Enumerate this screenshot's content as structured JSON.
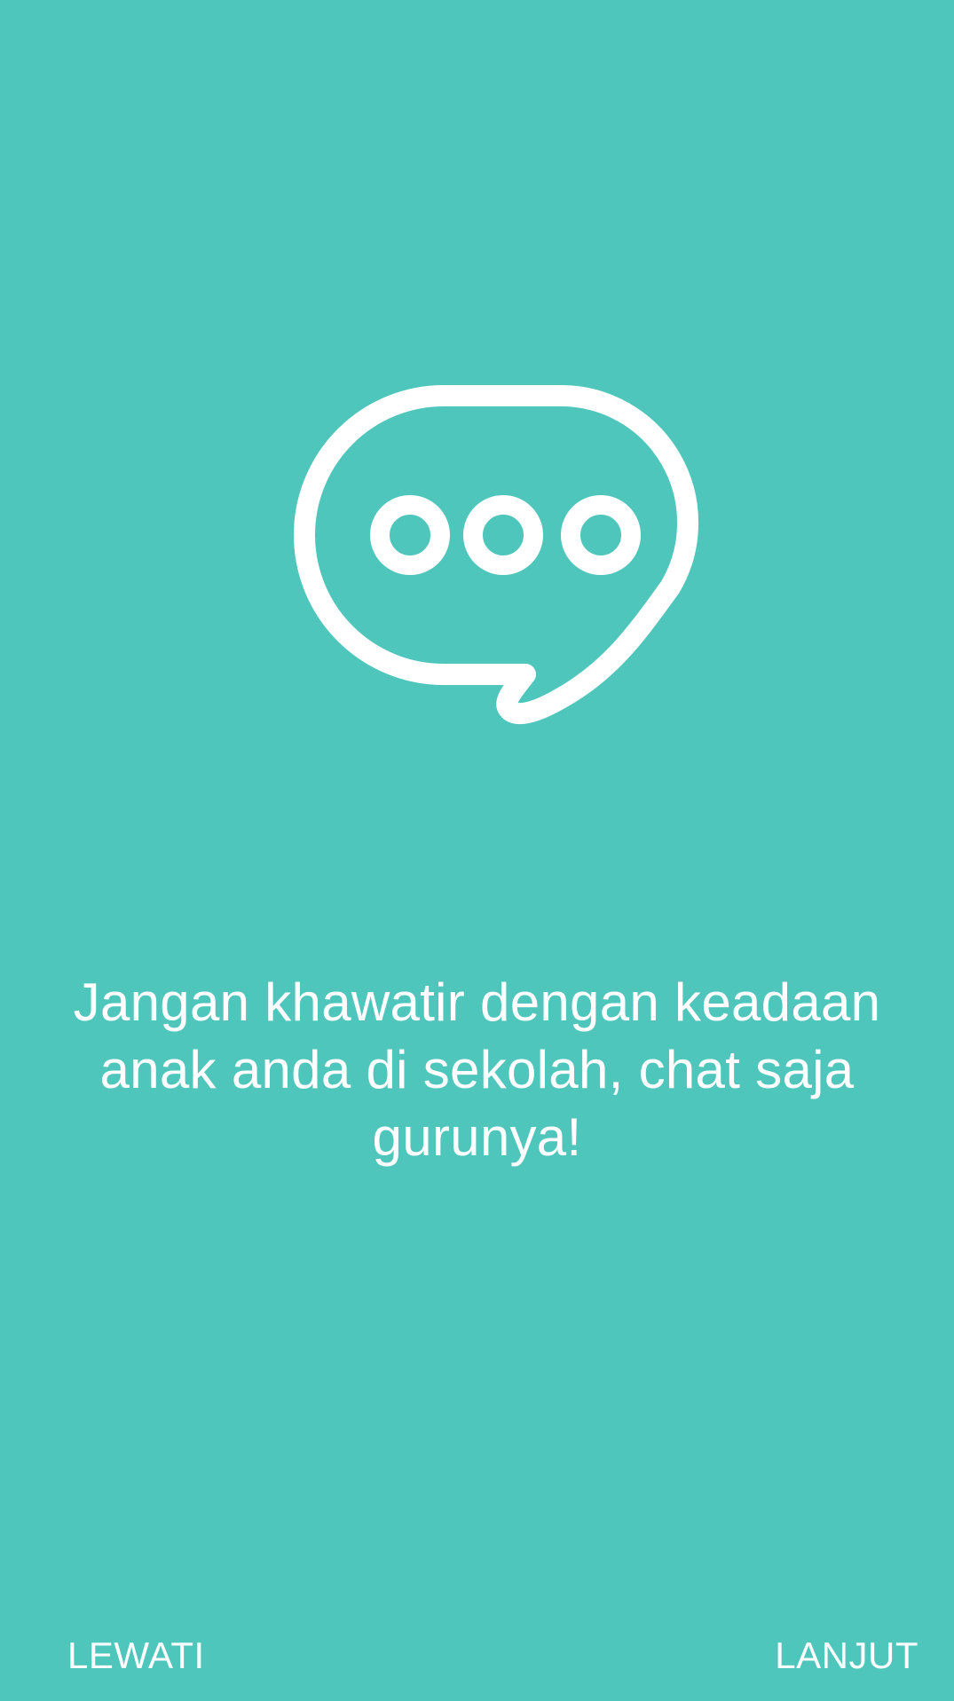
{
  "onboarding": {
    "message": "Jangan khawatir dengan keadaan anak anda di sekolah, chat saja gurunya!",
    "icon": "chat-bubble-icon"
  },
  "footer": {
    "skip_label": "LEWATI",
    "next_label": "LANJUT"
  },
  "colors": {
    "background": "#4fc6bc",
    "foreground": "#ffffff"
  }
}
